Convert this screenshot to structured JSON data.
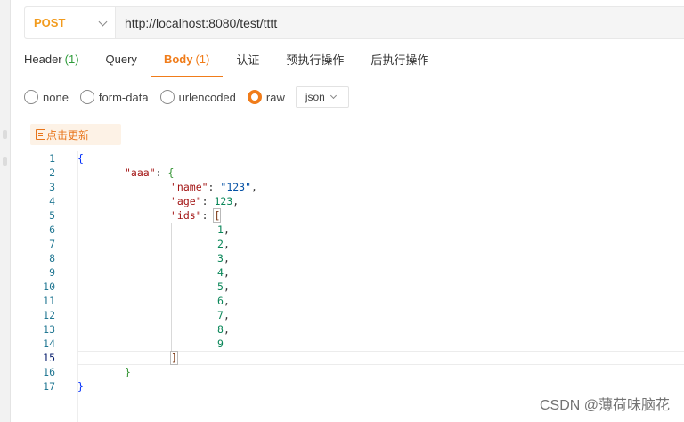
{
  "request": {
    "method": "POST",
    "url": "http://localhost:8080/test/tttt"
  },
  "tabs": [
    {
      "label": "Header",
      "count": "(1)"
    },
    {
      "label": "Query",
      "count": ""
    },
    {
      "label": "Body",
      "count": "(1)"
    },
    {
      "label": "认证",
      "count": ""
    },
    {
      "label": "预执行操作",
      "count": ""
    },
    {
      "label": "后执行操作",
      "count": ""
    }
  ],
  "active_tab": "Body",
  "body_types": [
    "none",
    "form-data",
    "urlencoded",
    "raw"
  ],
  "selected_body_type": "raw",
  "format_select": "json",
  "refresh_button": "点击更新",
  "code_lines": [
    {
      "n": "1"
    },
    {
      "n": "2"
    },
    {
      "n": "3"
    },
    {
      "n": "4"
    },
    {
      "n": "5"
    },
    {
      "n": "6"
    },
    {
      "n": "7"
    },
    {
      "n": "8"
    },
    {
      "n": "9"
    },
    {
      "n": "10"
    },
    {
      "n": "11"
    },
    {
      "n": "12"
    },
    {
      "n": "13"
    },
    {
      "n": "14"
    },
    {
      "n": "15"
    },
    {
      "n": "16"
    },
    {
      "n": "17"
    }
  ],
  "json_body": {
    "outer_key": "\"aaa\"",
    "name_key": "\"name\"",
    "name_value": "\"123\"",
    "age_key": "\"age\"",
    "age_value": "123",
    "ids_key": "\"ids\"",
    "ids": [
      "1",
      "2",
      "3",
      "4",
      "5",
      "6",
      "7",
      "8",
      "9"
    ]
  },
  "watermark": "CSDN @薄荷味脑花",
  "colors": {
    "accent": "#f07c1a",
    "method": "#f29b1d",
    "count": "#2f9c3b"
  }
}
